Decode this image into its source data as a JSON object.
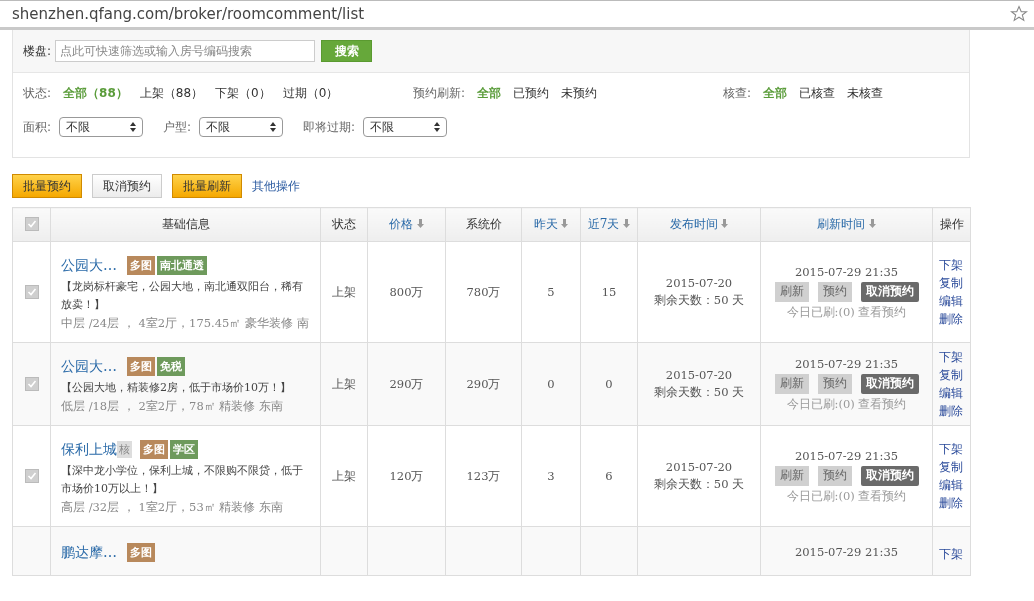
{
  "address_bar": {
    "url": "shenzhen.qfang.com/broker/roomcomment/list"
  },
  "search": {
    "label": "楼盘:",
    "placeholder": "点此可快速筛选或输入房号编码搜索",
    "button": "搜索"
  },
  "filters": [
    {
      "label": "状态:",
      "options": [
        {
          "label": "全部（88）",
          "selected": true
        },
        {
          "label": "上架（88）",
          "selected": false
        },
        {
          "label": "下架（0）",
          "selected": false
        },
        {
          "label": "过期（0）",
          "selected": false
        }
      ]
    },
    {
      "label": "预约刷新:",
      "options": [
        {
          "label": "全部",
          "selected": true
        },
        {
          "label": "已预约",
          "selected": false
        },
        {
          "label": "未预约",
          "selected": false
        }
      ]
    },
    {
      "label": "核查:",
      "options": [
        {
          "label": "全部",
          "selected": true
        },
        {
          "label": "已核查",
          "selected": false
        },
        {
          "label": "未核查",
          "selected": false
        }
      ]
    }
  ],
  "selects": [
    {
      "label": "面积:",
      "value": "不限"
    },
    {
      "label": "户型:",
      "value": "不限"
    },
    {
      "label": "即将过期:",
      "value": "不限"
    }
  ],
  "actions": [
    {
      "label": "批量预约",
      "kind": "primary"
    },
    {
      "label": "取消预约",
      "kind": "plain"
    },
    {
      "label": "批量刷新",
      "kind": "primary"
    },
    {
      "label": "其他操作",
      "kind": "link"
    }
  ],
  "table": {
    "select_all_checked": true,
    "columns": [
      {
        "label": "基础信息",
        "sortable": false
      },
      {
        "label": "状态",
        "sortable": false
      },
      {
        "label": "价格",
        "sortable": true
      },
      {
        "label": "系统价",
        "sortable": false
      },
      {
        "label": "昨天",
        "sortable": true
      },
      {
        "label": "近7天",
        "sortable": true
      },
      {
        "label": "发布时间",
        "sortable": true
      },
      {
        "label": "刷新时间",
        "sortable": true
      },
      {
        "label": "操作",
        "sortable": false
      }
    ],
    "rows": [
      {
        "checked": true,
        "title": "公园大…",
        "verified": null,
        "tags": [
          {
            "label": "多图",
            "color": "#b8895c"
          },
          {
            "label": "南北通透",
            "color": "#6e9a5c"
          }
        ],
        "description": "【龙岗标杆豪宅，公园大地，南北通双阳台，稀有放卖！】",
        "detail": "中层 /24层 ， 4室2厅，175.45㎡ 豪华装修 南",
        "status": "上架",
        "price": "800万",
        "system_price": "780万",
        "yesterday": "5",
        "week": "15",
        "publish_date": "2015-07-20",
        "remaining": "剩余天数：50 天",
        "refresh_time": "2015-07-29 21:35",
        "buttons": [
          {
            "label": "刷新",
            "kind": "gray"
          },
          {
            "label": "预约",
            "kind": "gray"
          },
          {
            "label": "取消预约",
            "kind": "dark"
          }
        ],
        "today": "今日已刷:(0)",
        "view_link": "查看预约",
        "ops": [
          "下架",
          "复制",
          "编辑",
          "删除"
        ]
      },
      {
        "checked": true,
        "title": "公园大…",
        "verified": null,
        "tags": [
          {
            "label": "多图",
            "color": "#b8895c"
          },
          {
            "label": "免税",
            "color": "#6e9a5c"
          }
        ],
        "description": "【公园大地，精装修2房，低于市场价10万！】",
        "detail": "低层 /18层 ， 2室2厅，78㎡ 精装修 东南",
        "status": "上架",
        "price": "290万",
        "system_price": "290万",
        "yesterday": "0",
        "week": "0",
        "publish_date": "2015-07-20",
        "remaining": "剩余天数：50 天",
        "refresh_time": "2015-07-29 21:35",
        "buttons": [
          {
            "label": "刷新",
            "kind": "gray"
          },
          {
            "label": "预约",
            "kind": "gray"
          },
          {
            "label": "取消预约",
            "kind": "dark"
          }
        ],
        "today": "今日已刷:(0)",
        "view_link": "查看预约",
        "ops": [
          "下架",
          "复制",
          "编辑",
          "删除"
        ]
      },
      {
        "checked": true,
        "title": "保利上城",
        "verified": "核",
        "tags": [
          {
            "label": "多图",
            "color": "#b8895c"
          },
          {
            "label": "学区",
            "color": "#6e9a5c"
          }
        ],
        "description": "【深中龙小学位，保利上城，不限购不限贷，低于市场价10万以上！】",
        "detail": "高层 /32层 ， 1室2厅，53㎡ 精装修 东南",
        "status": "上架",
        "price": "120万",
        "system_price": "123万",
        "yesterday": "3",
        "week": "6",
        "publish_date": "2015-07-20",
        "remaining": "剩余天数：50 天",
        "refresh_time": "2015-07-29 21:35",
        "buttons": [
          {
            "label": "刷新",
            "kind": "gray"
          },
          {
            "label": "预约",
            "kind": "gray"
          },
          {
            "label": "取消预约",
            "kind": "dark"
          }
        ],
        "today": "今日已刷:(0)",
        "view_link": "查看预约",
        "ops": [
          "下架",
          "复制",
          "编辑",
          "删除"
        ]
      },
      {
        "title": "鹏达摩…",
        "verified": null,
        "tags": [
          {
            "label": "多图",
            "color": "#b8895c"
          }
        ],
        "refresh_time": "2015-07-29 21:35",
        "ops": [
          "下架"
        ]
      }
    ]
  }
}
